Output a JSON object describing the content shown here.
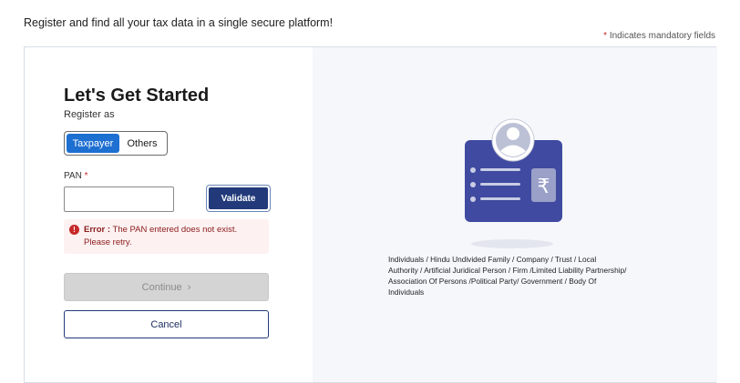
{
  "header": {
    "tagline": "Register and find all your tax data in a single secure platform!",
    "mandatory_star": "*",
    "mandatory_text": "Indicates mandatory fields"
  },
  "form": {
    "heading": "Let's Get Started",
    "register_as": "Register as",
    "toggle": {
      "options": [
        "Taxpayer",
        "Others"
      ],
      "selected": "Taxpayer"
    },
    "pan": {
      "label": "PAN",
      "required_star": "*",
      "value": "",
      "placeholder": ""
    },
    "validate_label": "Validate",
    "error": {
      "icon": "!",
      "title": "Error :",
      "message": "The PAN entered does not exist. Please retry."
    },
    "continue_label": "Continue",
    "continue_chevron": "›",
    "cancel_label": "Cancel"
  },
  "illustration": {
    "icon": "id-card-rupee-illustration",
    "currency_symbol": "₹",
    "entities_text": "Individuals / Hindu Undivided Family / Company / Trust / Local Authority / Artificial Juridical Person / Firm /Limited Liability Partnership/ Association Of Persons /Political Party/ Government / Body Of Individuals"
  },
  "colors": {
    "primary": "#223a7a",
    "toggle_active": "#1d6fd1",
    "card_purple": "#3f4aa0",
    "error_text": "#8a1c1c",
    "error_bg": "#fdf1f1",
    "mandatory_star": "#c62828"
  }
}
